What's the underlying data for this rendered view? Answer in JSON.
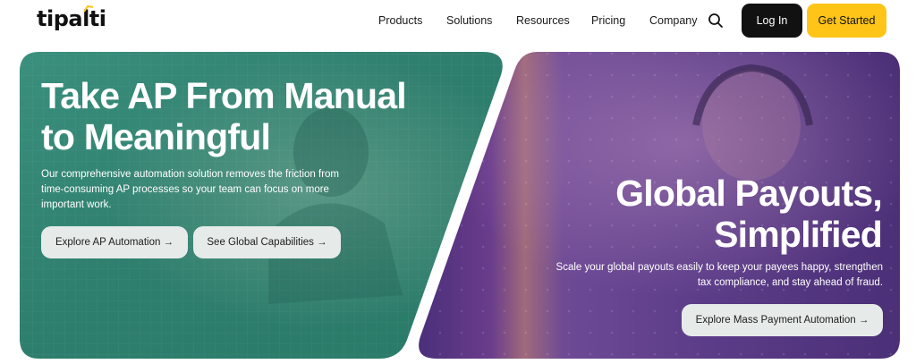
{
  "header": {
    "logo_text": "tipalti",
    "nav": [
      {
        "label": "Products"
      },
      {
        "label": "Solutions"
      },
      {
        "label": "Resources"
      },
      {
        "label": "Pricing"
      },
      {
        "label": "Company"
      }
    ],
    "search_icon": "search-icon",
    "login_label": "Log In",
    "get_started_label": "Get Started"
  },
  "hero_left": {
    "title_line1": "Take AP From Manual",
    "title_line2": "to Meaningful",
    "description": "Our comprehensive automation solution removes the friction from time-consuming AP processes so your team can focus on more important work.",
    "buttons": [
      {
        "label": "Explore AP Automation →"
      },
      {
        "label": "See Global Capabilities →"
      }
    ]
  },
  "hero_right": {
    "title_line1": "Global Payouts,",
    "title_line2": "Simplified",
    "description": "Scale your global payouts easily to keep your payees happy, strengthen tax compliance, and stay ahead of fraud.",
    "button_label": "Explore Mass Payment Automation →"
  },
  "colors": {
    "left_card": "#2f8f7c",
    "right_card": "#5a3e86",
    "accent_yellow": "#fec418",
    "dark": "#111111"
  }
}
